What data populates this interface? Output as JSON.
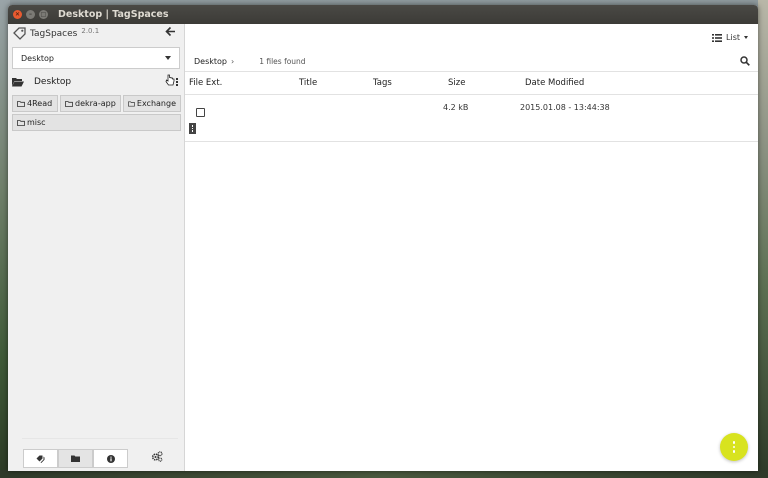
{
  "window": {
    "title": "Desktop | TagSpaces"
  },
  "app": {
    "name": "TagSpaces",
    "version": "2.0.1"
  },
  "sidebar": {
    "location": "Desktop",
    "current_dir": "Desktop",
    "subdirs": [
      "4Read",
      "dekra-app",
      "Exchange",
      "misc"
    ]
  },
  "topbar": {
    "view_label": "List"
  },
  "breadcrumb": {
    "path": "Desktop",
    "separator": "›",
    "found_text": "1 files found"
  },
  "table": {
    "headers": {
      "ext": "File Ext.",
      "title": "Title",
      "tags": "Tags",
      "size": "Size",
      "date": "Date Modified"
    },
    "rows": [
      {
        "ext": "",
        "title": "",
        "tags": "",
        "size": "4.2 kB",
        "date": "2015.01.08 - 13:44:38"
      }
    ]
  },
  "colors": {
    "accent": "#d8e31f",
    "titlebar": "#3c3b37",
    "sidebar_bg": "#f0f0f0"
  }
}
